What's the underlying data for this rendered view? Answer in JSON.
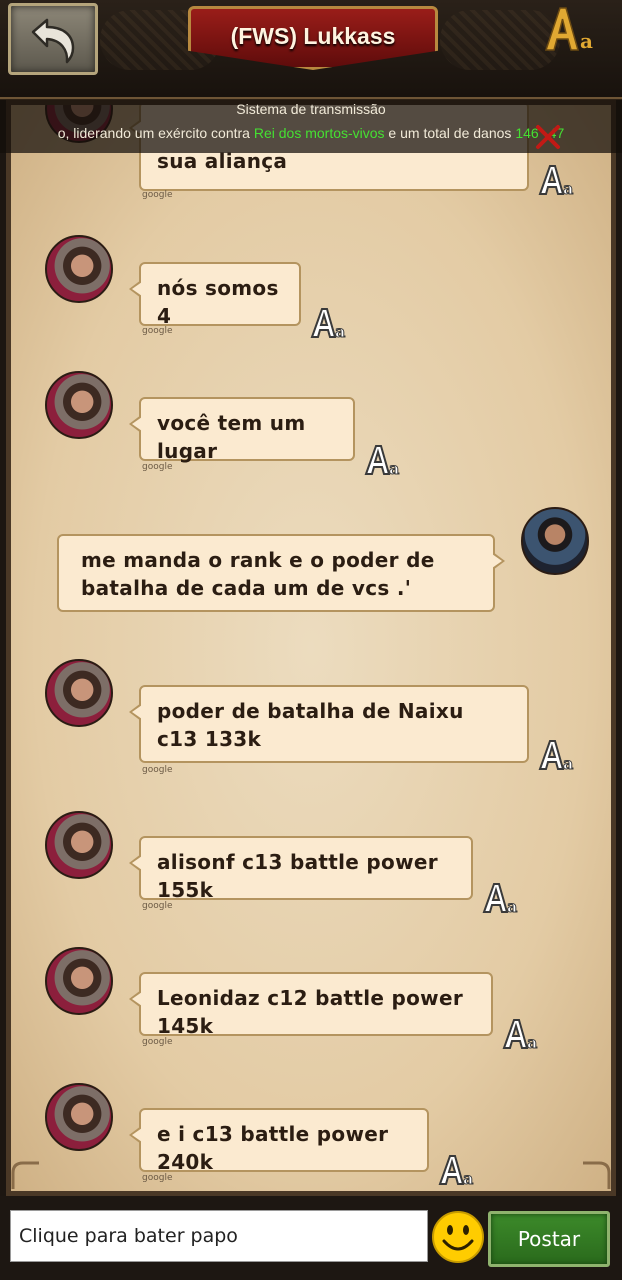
{
  "header": {
    "title": "(FWS) Lukkass",
    "back_icon": "back-arrow-icon",
    "font_icon": "font-size-icon"
  },
  "broadcast": {
    "title": "Sistema de transmissão",
    "text_before": "o, liderando um exército contra ",
    "highlight": "Rei dos mortos-vivos",
    "text_after": " e um total de danos ",
    "damage_start": "146",
    "damage_end": "47",
    "colors": {
      "highlight": "#45e032"
    }
  },
  "messages": [
    {
      "side": "left",
      "text": "e nós decidimos que nós para a sua aliança",
      "visible_text": "sua aliança",
      "source": "google"
    },
    {
      "side": "left",
      "text": "nós somos 4",
      "source": "google"
    },
    {
      "side": "left",
      "text": "você tem um lugar",
      "source": "google"
    },
    {
      "side": "right",
      "text": "me manda o rank e o poder de batalha de cada um de vcs .'"
    },
    {
      "side": "left",
      "text": "poder de batalha de Naixu c13 133k",
      "source": "google"
    },
    {
      "side": "left",
      "text": "alisonf c13 battle power 155k",
      "source": "google"
    },
    {
      "side": "left",
      "text": "Leonidaz c12 battle power 145k",
      "source": "google"
    },
    {
      "side": "left",
      "text": "e i c13 battle power 240k",
      "source": "google"
    }
  ],
  "composer": {
    "placeholder": "Clique para bater papo",
    "post_label": "Postar",
    "emoji_icon": "smiley-icon"
  },
  "colors": {
    "bubble": "#fbead0",
    "bubble_border": "#b4945f",
    "post_button": "#2f7420",
    "banner": "#8a1a17"
  }
}
